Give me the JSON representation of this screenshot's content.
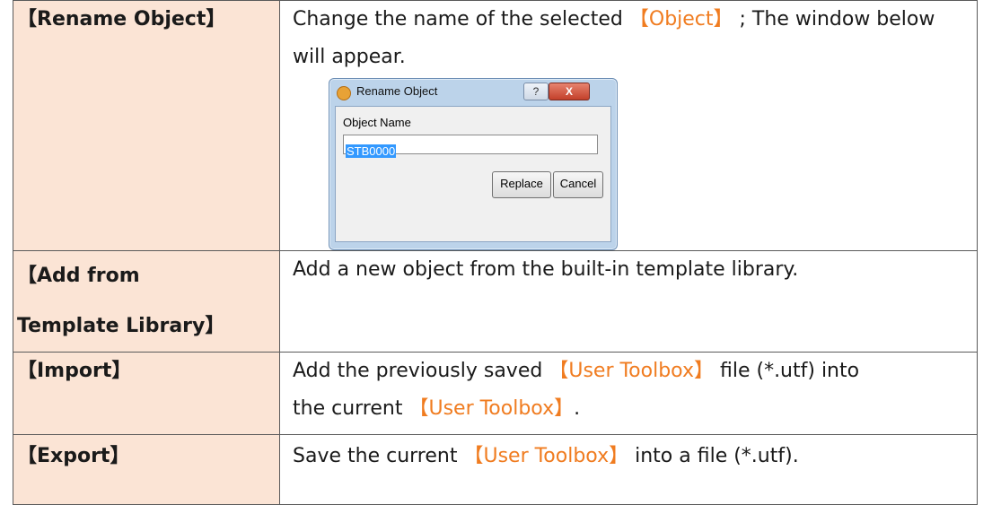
{
  "rows": [
    {
      "term": "【Rename Object】",
      "desc_pre": "Change the name of the selected",
      "desc_hl": "【Object】",
      "desc_post": "; The window below will appear."
    },
    {
      "term_l1": "【Add from",
      "term_l2": "Template Library】",
      "desc": "Add a new object from the built-in template library."
    },
    {
      "term": "【Import】",
      "desc_pre": "Add the previously saved",
      "desc_hl": "【User Toolbox】",
      "desc_mid": "file (*.utf) into",
      "desc_pre2": "the current",
      "desc_hl2": "【User Toolbox】",
      "desc_post": "."
    },
    {
      "term": "【Export】",
      "desc_pre": "Save the current",
      "desc_hl": "【User Toolbox】",
      "desc_post": "into a file (*.utf)."
    }
  ],
  "dialog": {
    "title": "Rename Object",
    "help_label": "?",
    "close_label": "X",
    "field_label": "Object Name",
    "field_value": "STB0000",
    "replace_label": "Replace",
    "cancel_label": "Cancel"
  },
  "colors": {
    "term_bg": "#fbe4d5",
    "term_text": "#e36c0a",
    "highlight": "#f07c20"
  }
}
